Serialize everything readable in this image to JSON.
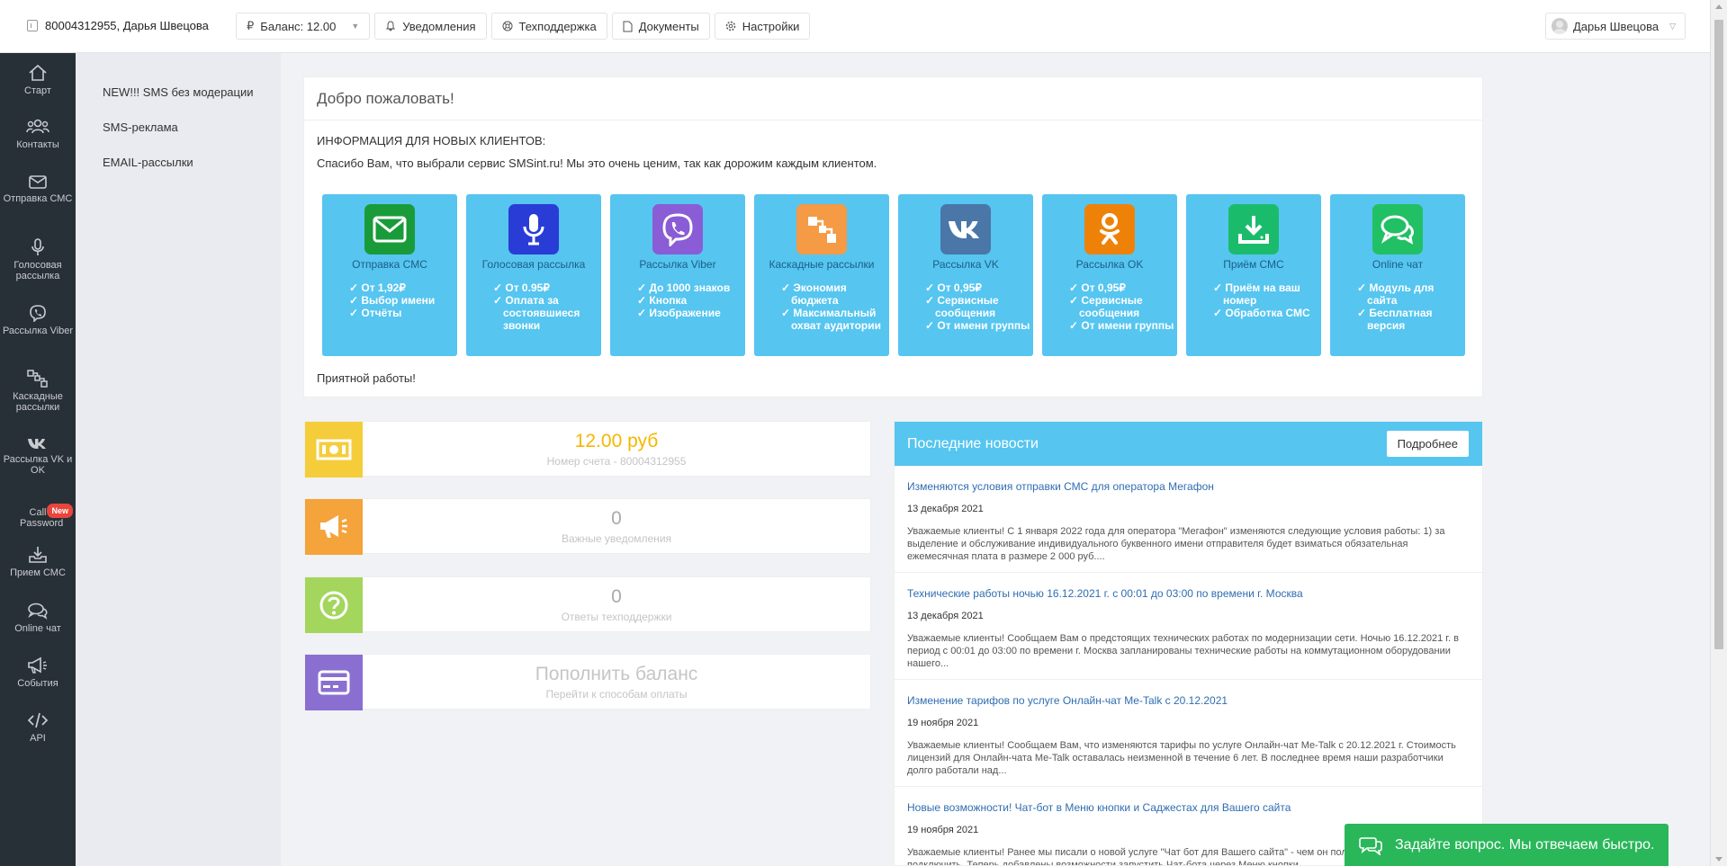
{
  "topbar": {
    "account": "80004312955, Дарья Швецова",
    "balance": "Баланс: 12.00",
    "balance_symbol": "₽",
    "notifications": "Уведомления",
    "support": "Техподдержка",
    "documents": "Документы",
    "settings": "Настройки",
    "user": "Дарья Швецова"
  },
  "sidebar": {
    "items": [
      {
        "label": "Старт",
        "icon": "home-icon"
      },
      {
        "label": "Контакты",
        "icon": "contacts-icon"
      },
      {
        "label": "Отправка СМС",
        "icon": "mail-icon"
      },
      {
        "label": "Голосовая рассылка",
        "icon": "mic-icon"
      },
      {
        "label": "Рассылка Viber",
        "icon": "viber-icon"
      },
      {
        "label": "Каскадные рассылки",
        "icon": "cascade-icon"
      },
      {
        "label": "Рассылка VK и OK",
        "icon": "vk-icon"
      },
      {
        "label": "Call Password",
        "icon": "call-icon",
        "badge": "New"
      },
      {
        "label": "Прием СМС",
        "icon": "inbox-icon"
      },
      {
        "label": "Online чат",
        "icon": "chat-icon"
      },
      {
        "label": "События",
        "icon": "megaphone-icon"
      },
      {
        "label": "API",
        "icon": "code-icon"
      }
    ]
  },
  "submenu": {
    "items": [
      "NEW!!! SMS без модерации",
      "SMS-реклама",
      "EMAIL-рассылки"
    ]
  },
  "welcome": {
    "title": "Добро пожаловать!",
    "info": "ИНФОРМАЦИЯ ДЛЯ НОВЫХ КЛИЕНТОВ:",
    "thanks": "Спасибо Вам, что выбрали сервис SMSint.ru! Мы это очень ценим, так как дорожим каждым клиентом.",
    "bye": "Приятной работы!",
    "tiles": [
      {
        "name": "Отправка СМС",
        "color": "#1a9b3a",
        "icon": "mail-icon",
        "points": [
          "От 1,92₽",
          "Выбор имени",
          "Отчёты"
        ]
      },
      {
        "name": "Голосовая рассылка",
        "color": "#2a3cd6",
        "icon": "mic-icon",
        "points": [
          "От 0.95₽",
          "Оплата за состоявшиеся звонки"
        ]
      },
      {
        "name": "Рассылка Viber",
        "color": "#8a5cd6",
        "icon": "viber-icon",
        "points": [
          "До 1000 знаков",
          "Кнопка",
          "Изображение"
        ]
      },
      {
        "name": "Каскадные рассылки",
        "color": "#f59a45",
        "icon": "cascade-icon",
        "points": [
          "Экономия бюджета",
          "Максимальный охват аудитории"
        ]
      },
      {
        "name": "Рассылка VK",
        "color": "#4a76a8",
        "icon": "vk-icon",
        "points": [
          "От 0,95₽",
          "Сервисные сообщения",
          "От имени группы"
        ]
      },
      {
        "name": "Рассылка OK",
        "color": "#ee8208",
        "icon": "ok-icon",
        "points": [
          "От 0,95₽",
          "Сервисные сообщения",
          "От имени группы"
        ]
      },
      {
        "name": "Приём СМС",
        "color": "#1abc6c",
        "icon": "download-icon",
        "points": [
          "Приём на ваш номер",
          "Обработка СМС"
        ]
      },
      {
        "name": "Online чат",
        "color": "#22c065",
        "icon": "chat-icon",
        "points": [
          "Модуль для сайта",
          "Бесплатная версия"
        ]
      }
    ]
  },
  "stats": [
    {
      "value": "12.00 руб",
      "label": "Номер счета - 80004312955",
      "color": "#f5cd3b",
      "value_color": "#f5b700",
      "icon": "money-icon"
    },
    {
      "value": "0",
      "label": "Важные уведомления",
      "color": "#f5a33b",
      "value_color": "#aaaaaa",
      "icon": "megaphone-icon"
    },
    {
      "value": "0",
      "label": "Ответы техподдержки",
      "color": "#a4d65e",
      "value_color": "#aaaaaa",
      "icon": "question-icon"
    },
    {
      "value": "Пополнить баланс",
      "label": "Перейти к способам оплаты",
      "color": "#8a6fd0",
      "value_color": "#c5c5c5",
      "icon": "card-icon"
    }
  ],
  "news": {
    "title": "Последние новости",
    "more": "Подробнее",
    "items": [
      {
        "title": "Изменяются условия отправки СМС для оператора Мегафон",
        "date": "13 декабря 2021",
        "text": "Уважаемые клиенты! С 1 января 2022 года для оператора \"Мегафон\" изменяются следующие условия работы:  1) за выделение и обслуживание индивидуального буквенного имени отправителя будет взиматься обязательная ежемесячная плата в размере 2 000 руб...."
      },
      {
        "title": "Технические работы ночью 16.12.2021 г. с 00:01 до 03:00 по времени г. Москва",
        "date": "13 декабря 2021",
        "text": "Уважаемые клиенты! Сообщаем Вам о предстоящих технических работах по модернизации сети. Ночью 16.12.2021 г. в период с 00:01 до 03:00 по времени г. Москва запланированы технические работы на коммутационном оборудовании нашего..."
      },
      {
        "title": "Изменение тарифов по услуге Онлайн-чат Me-Talk с 20.12.2021",
        "date": "19 ноября 2021",
        "text": "Уважаемые клиенты! Сообщаем Вам, что изменяются тарифы по услуге Онлайн-чат Me-Talk с 20.12.2021 г. Стоимость лицензий для Онлайн-чата Me-Talk оставалась неизменной в течение 6 лет. В последнее время наши разработчики долго работали над..."
      },
      {
        "title": "Новые возможности! Чат-бот в Меню кнопки и Саджестах для Вашего сайта",
        "date": "19 ноября 2021",
        "text": "Уважаемые клиенты! Ранее мы писали о новой услуге \"Чат бот для Вашего сайта\" - чем он полезен и как его подключить. Теперь добавлены возможности запустить Чат-бота через Меню кнопки..."
      }
    ]
  },
  "chat_widget": {
    "label": "Задайте вопрос. Мы отвечаем быстро."
  }
}
